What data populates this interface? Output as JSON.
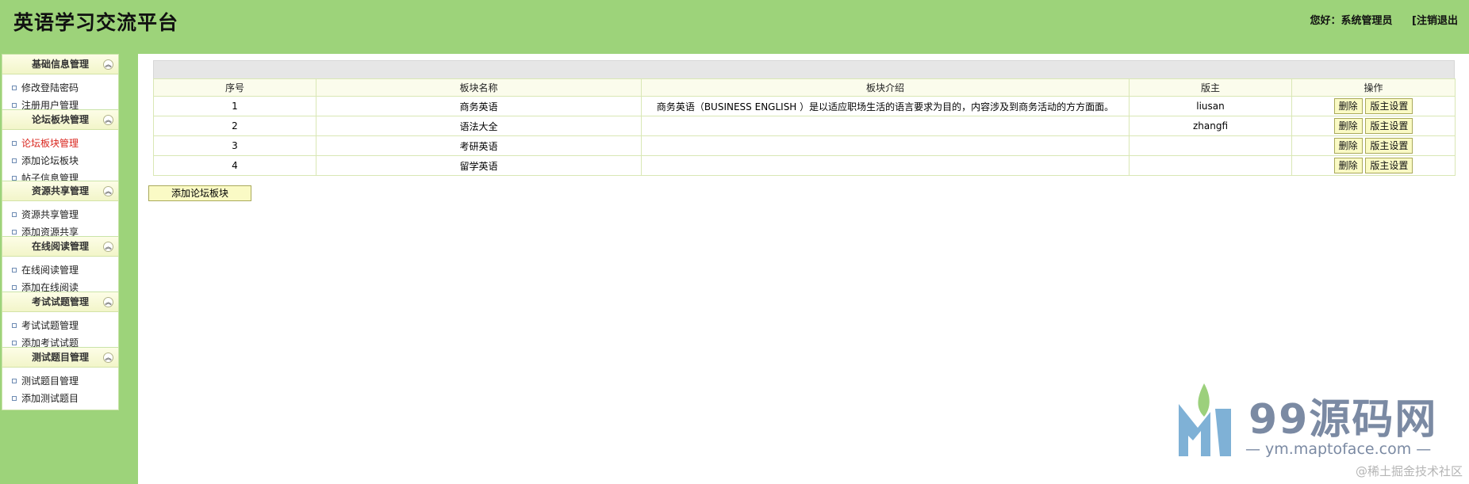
{
  "header": {
    "title": "英语学习交流平台",
    "greeting": "您好：系统管理员",
    "logout": "[注销退出"
  },
  "sidebar": {
    "groups": [
      {
        "title": "基础信息管理",
        "items": [
          "修改登陆密码",
          "注册用户管理"
        ]
      },
      {
        "title": "论坛板块管理",
        "items": [
          "论坛板块管理",
          "添加论坛板块",
          "帖子信息管理"
        ]
      },
      {
        "title": "资源共享管理",
        "items": [
          "资源共享管理",
          "添加资源共享"
        ]
      },
      {
        "title": "在线阅读管理",
        "items": [
          "在线阅读管理",
          "添加在线阅读"
        ]
      },
      {
        "title": "考试试题管理",
        "items": [
          "考试试题管理",
          "添加考试试题"
        ]
      },
      {
        "title": "测试题目管理",
        "items": [
          "测试题目管理",
          "添加测试题目"
        ]
      }
    ],
    "collapse_icon": "chevron-up-double-icon",
    "active_item": "论坛板块管理"
  },
  "table": {
    "columns": [
      "序号",
      "板块名称",
      "板块介绍",
      "版主",
      "操作"
    ],
    "rows": [
      {
        "no": "1",
        "name": "商务英语",
        "intro": "商务英语（BUSINESS ENGLISH ）是以适应职场生活的语言要求为目的，内容涉及到商务活动的方方面面。",
        "moderator": "liusan"
      },
      {
        "no": "2",
        "name": "语法大全",
        "intro": "",
        "moderator": "zhangfi"
      },
      {
        "no": "3",
        "name": "考研英语",
        "intro": "",
        "moderator": ""
      },
      {
        "no": "4",
        "name": "留学英语",
        "intro": "",
        "moderator": ""
      }
    ],
    "delete_label": "删除",
    "set_moderator_label": "版主设置"
  },
  "add_button_label": "添加论坛板块",
  "watermark": {
    "title": "99源码网",
    "url": "— ym.maptoface.com —",
    "corner": "@稀土掘金技术社区"
  },
  "colors": {
    "header_bg": "#9dd37a",
    "accent_active": "#d9251d",
    "button_bg": "#fafac5"
  }
}
